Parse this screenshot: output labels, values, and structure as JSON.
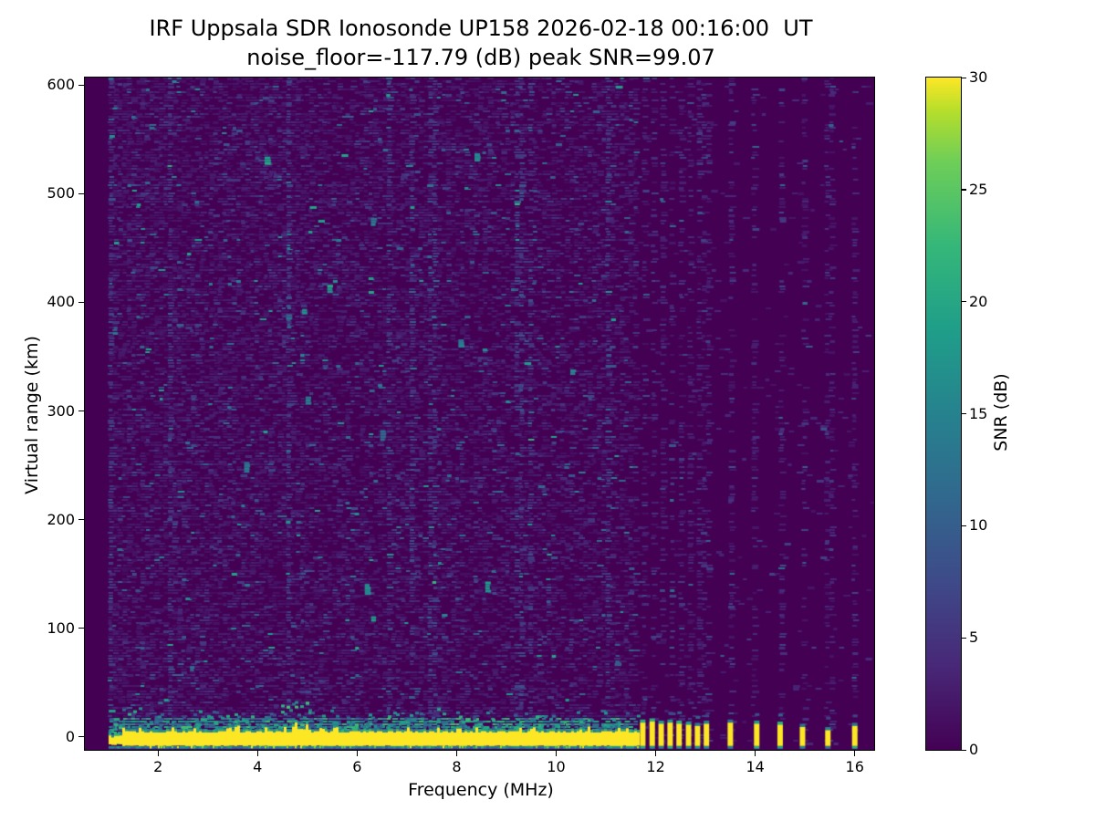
{
  "figure": {
    "title": "IRF Uppsala SDR Ionosonde UP158 2026-02-18 00:16:00  UT",
    "subtitle": "noise_floor=-117.79 (dB) peak SNR=99.07",
    "background_color": "#ffffff"
  },
  "chart_data": {
    "type": "heatmap",
    "title": "IRF Uppsala SDR Ionosonde UP158 2026-02-18 00:16:00  UT",
    "subtitle": "noise_floor=-117.79 (dB) peak SNR=99.07",
    "xlabel": "Frequency (MHz)",
    "ylabel": "Virtual range (km)",
    "xlim": [
      0.53,
      16.39
    ],
    "ylim": [
      -12,
      607
    ],
    "x_ticks": [
      2,
      4,
      6,
      8,
      10,
      12,
      14,
      16
    ],
    "y_ticks": [
      0,
      100,
      200,
      300,
      400,
      500,
      600
    ],
    "grid": false,
    "legend": "none",
    "colorbar": {
      "label": "SNR (dB)",
      "ticks": [
        0,
        5,
        10,
        15,
        20,
        25,
        30
      ],
      "vmin": 0,
      "vmax": 30,
      "colormap": "viridis"
    },
    "viridis_stops": [
      [
        0,
        "#440154"
      ],
      [
        0.125,
        "#482878"
      ],
      [
        0.25,
        "#3e4a89"
      ],
      [
        0.375,
        "#31688e"
      ],
      [
        0.5,
        "#26828e"
      ],
      [
        0.625,
        "#1f9e89"
      ],
      [
        0.75,
        "#35b779"
      ],
      [
        0.875,
        "#6ece58"
      ],
      [
        0.95,
        "#b5de2b"
      ],
      [
        1,
        "#fde725"
      ]
    ],
    "content": {
      "noise_floor_db": -117.79,
      "peak_snr_db": 99.07,
      "sweep_start_mhz": 1.0,
      "background_snr_db": 0,
      "background_color": "#440154",
      "ground_echo_band": {
        "range_km_top": 4,
        "range_km_bottom": -8,
        "mhz_start": 1.0,
        "mhz_end": 11.65,
        "snr_db": 30,
        "color": "#fde725",
        "green_bump_mhz": [
          4.45,
          5.05
        ]
      },
      "sub_band_line": {
        "range_km_top": -8.5,
        "range_km_bottom": -11,
        "snr_db": 15
      },
      "rfi_bars": [
        {
          "mhz": 11.74,
          "top_km": 13
        },
        {
          "mhz": 11.93,
          "top_km": 14
        },
        {
          "mhz": 12.11,
          "top_km": 12
        },
        {
          "mhz": 12.29,
          "top_km": 13
        },
        {
          "mhz": 12.47,
          "top_km": 12
        },
        {
          "mhz": 12.66,
          "top_km": 11
        },
        {
          "mhz": 12.84,
          "top_km": 10
        },
        {
          "mhz": 13.02,
          "top_km": 12
        },
        {
          "mhz": 13.5,
          "top_km": 13
        },
        {
          "mhz": 14.03,
          "top_km": 12
        },
        {
          "mhz": 14.5,
          "top_km": 11
        },
        {
          "mhz": 14.95,
          "top_km": 9
        },
        {
          "mhz": 15.46,
          "top_km": 6
        },
        {
          "mhz": 16.0,
          "top_km": 10
        }
      ],
      "rfi_column_cluster": {
        "mhz_start": 11.65,
        "mhz_end": 12.95,
        "spacing_mhz": 0.183
      },
      "sparse_columns": {
        "mhz_start": 12.95,
        "anchor_mhz": 13.02,
        "spacing_mhz": 0.49
      },
      "speckle": {
        "seed": 7,
        "density_below_5mhz": 0.55,
        "density_5_to_8mhz": 0.5,
        "density_8_to_11mhz": 0.45,
        "column_density_above_12mhz": 0.36,
        "teal_streak_count": 14,
        "hot_column_fraction": 0.09
      }
    }
  }
}
